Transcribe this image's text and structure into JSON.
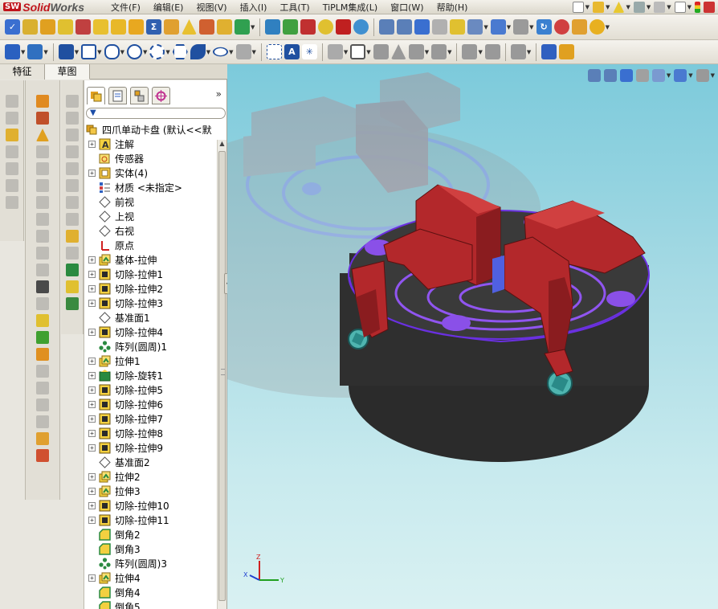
{
  "app": {
    "logo_badge": "SW",
    "name_left": "Solid",
    "name_right": "Works"
  },
  "menu": [
    "文件(F)",
    "编辑(E)",
    "视图(V)",
    "插入(I)",
    "工具(T)",
    "TiPLM集成(L)",
    "窗口(W)",
    "帮助(H)"
  ],
  "tabs": [
    "特征",
    "草图"
  ],
  "active_tab": "草图",
  "feature_tree": {
    "root": "四爪单动卡盘  (默认<<默",
    "items": [
      {
        "label": "注解",
        "icon": "annotation-icon",
        "expand": true
      },
      {
        "label": "传感器",
        "icon": "sensor-icon",
        "expand": false
      },
      {
        "label": "实体(4)",
        "icon": "solid-body-icon",
        "expand": true
      },
      {
        "label": "材质 <未指定>",
        "icon": "material-icon",
        "expand": false
      },
      {
        "label": "前视",
        "icon": "plane-icon",
        "expand": false
      },
      {
        "label": "上视",
        "icon": "plane-icon",
        "expand": false
      },
      {
        "label": "右视",
        "icon": "plane-icon",
        "expand": false
      },
      {
        "label": "原点",
        "icon": "origin-icon",
        "expand": false
      },
      {
        "label": "基体-拉伸",
        "icon": "extrude-icon",
        "expand": true
      },
      {
        "label": "切除-拉伸1",
        "icon": "cut-extrude-icon",
        "expand": true
      },
      {
        "label": "切除-拉伸2",
        "icon": "cut-extrude-icon",
        "expand": true
      },
      {
        "label": "切除-拉伸3",
        "icon": "cut-extrude-icon",
        "expand": true
      },
      {
        "label": "基准面1",
        "icon": "plane-icon",
        "expand": false
      },
      {
        "label": "切除-拉伸4",
        "icon": "cut-extrude-icon",
        "expand": true
      },
      {
        "label": "阵列(圆周)1",
        "icon": "circular-pattern-icon",
        "expand": false
      },
      {
        "label": "拉伸1",
        "icon": "extrude-icon",
        "expand": true
      },
      {
        "label": "切除-旋转1",
        "icon": "cut-revolve-icon",
        "expand": true
      },
      {
        "label": "切除-拉伸5",
        "icon": "cut-extrude-icon",
        "expand": true
      },
      {
        "label": "切除-拉伸6",
        "icon": "cut-extrude-icon",
        "expand": true
      },
      {
        "label": "切除-拉伸7",
        "icon": "cut-extrude-icon",
        "expand": true
      },
      {
        "label": "切除-拉伸8",
        "icon": "cut-extrude-icon",
        "expand": true
      },
      {
        "label": "切除-拉伸9",
        "icon": "cut-extrude-icon",
        "expand": true
      },
      {
        "label": "基准面2",
        "icon": "plane-icon",
        "expand": false
      },
      {
        "label": "拉伸2",
        "icon": "extrude-icon",
        "expand": true
      },
      {
        "label": "拉伸3",
        "icon": "extrude-icon",
        "expand": true
      },
      {
        "label": "切除-拉伸10",
        "icon": "cut-extrude-icon",
        "expand": true
      },
      {
        "label": "切除-拉伸11",
        "icon": "cut-extrude-icon",
        "expand": true
      },
      {
        "label": "倒角2",
        "icon": "chamfer-icon",
        "expand": false
      },
      {
        "label": "倒角3",
        "icon": "chamfer-icon",
        "expand": false
      },
      {
        "label": "阵列(圆周)3",
        "icon": "circular-pattern-icon",
        "expand": false
      },
      {
        "label": "拉伸4",
        "icon": "extrude-icon",
        "expand": true
      },
      {
        "label": "倒角4",
        "icon": "chamfer-icon",
        "expand": false
      },
      {
        "label": "倒角5",
        "icon": "chamfer-icon",
        "expand": false
      }
    ]
  },
  "triad": {
    "x": "X",
    "y": "Y",
    "z": "Z"
  },
  "colors": {
    "jaw_red": "#b3282b",
    "body_dark": "#2f2f2f",
    "accent_purple": "#8a3fe6",
    "viewport_top": "#7ccadb",
    "viewport_bottom": "#d9f1f2"
  }
}
